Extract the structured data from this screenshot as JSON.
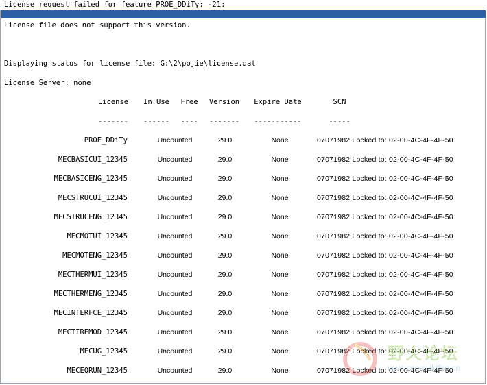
{
  "title": "License request failed for feature PROE_DDiTy: -21:",
  "message": "License file does not support this version.",
  "status_line": "Displaying status for license file: G:\\2\\pojie\\license.dat",
  "server_line": "License Server: none",
  "table": {
    "headers": [
      "License",
      "In Use",
      "Free",
      "Version",
      "Expire Date",
      "SCN"
    ],
    "dashes": [
      "-------",
      "------",
      "----",
      "-------",
      "-----------",
      "-----"
    ],
    "rows": [
      {
        "license": "PROE_DDiTy",
        "in_use": "Uncounted",
        "version": "29.0",
        "expire": "None",
        "scn": "07071982 Locked to: 02-00-4C-4F-4F-50"
      },
      {
        "license": "MECBASICUI_12345",
        "in_use": "Uncounted",
        "version": "29.0",
        "expire": "None",
        "scn": "07071982 Locked to: 02-00-4C-4F-4F-50"
      },
      {
        "license": "MECBASICENG_12345",
        "in_use": "Uncounted",
        "version": "29.0",
        "expire": "None",
        "scn": "07071982 Locked to: 02-00-4C-4F-4F-50"
      },
      {
        "license": "MECSTRUCUI_12345",
        "in_use": "Uncounted",
        "version": "29.0",
        "expire": "None",
        "scn": "07071982 Locked to: 02-00-4C-4F-4F-50"
      },
      {
        "license": "MECSTRUCENG_12345",
        "in_use": "Uncounted",
        "version": "29.0",
        "expire": "None",
        "scn": "07071982 Locked to: 02-00-4C-4F-4F-50"
      },
      {
        "license": "MECMOTUI_12345",
        "in_use": "Uncounted",
        "version": "29.0",
        "expire": "None",
        "scn": "07071982 Locked to: 02-00-4C-4F-4F-50"
      },
      {
        "license": "MECMOTENG_12345",
        "in_use": "Uncounted",
        "version": "29.0",
        "expire": "None",
        "scn": "07071982 Locked to: 02-00-4C-4F-4F-50"
      },
      {
        "license": "MECTHERMUI_12345",
        "in_use": "Uncounted",
        "version": "29.0",
        "expire": "None",
        "scn": "07071982 Locked to: 02-00-4C-4F-4F-50"
      },
      {
        "license": "MECTHERMENG_12345",
        "in_use": "Uncounted",
        "version": "29.0",
        "expire": "None",
        "scn": "07071982 Locked to: 02-00-4C-4F-4F-50"
      },
      {
        "license": "MECINTERFCE_12345",
        "in_use": "Uncounted",
        "version": "29.0",
        "expire": "None",
        "scn": "07071982 Locked to: 02-00-4C-4F-4F-50"
      },
      {
        "license": "MECTIREMOD_12345",
        "in_use": "Uncounted",
        "version": "29.0",
        "expire": "None",
        "scn": "07071982 Locked to: 02-00-4C-4F-4F-50"
      },
      {
        "license": "MECUG_12345",
        "in_use": "Uncounted",
        "version": "29.0",
        "expire": "None",
        "scn": "07071982 Locked to: 02-00-4C-4F-4F-50"
      },
      {
        "license": "MECEQRUN_12345",
        "in_use": "Uncounted",
        "version": "29.0",
        "expire": "None",
        "scn": "07071982 Locked to: 02-00-4C-4F-4F-50"
      }
    ]
  },
  "watermark": {
    "text": "野火论坛",
    "url": "www.proewildfire.cn"
  }
}
